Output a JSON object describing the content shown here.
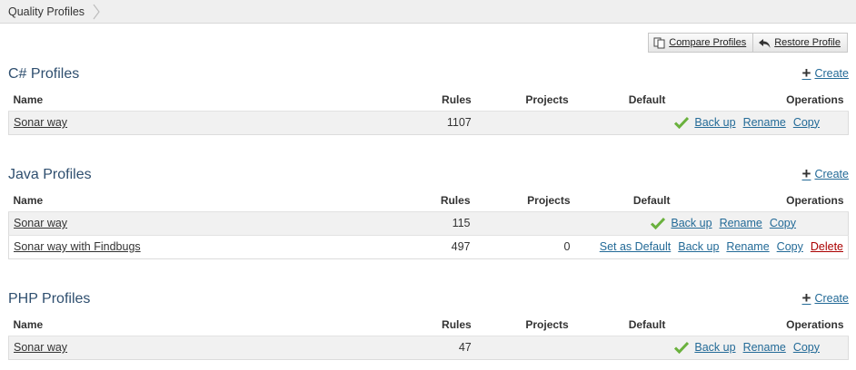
{
  "breadcrumb": {
    "label": "Quality Profiles"
  },
  "toolbar": {
    "compare_label": "Compare Profiles",
    "restore_label": "Restore Profile"
  },
  "columns": {
    "name": "Name",
    "rules": "Rules",
    "projects": "Projects",
    "default": "Default",
    "operations": "Operations"
  },
  "actions": {
    "create": "Create",
    "backup": "Back up",
    "rename": "Rename",
    "copy": "Copy",
    "delete": "Delete",
    "set_default": "Set as Default"
  },
  "sections": [
    {
      "title": "C# Profiles",
      "rows": [
        {
          "name": "Sonar way",
          "rules": "1107",
          "projects": "",
          "is_default": true
        }
      ]
    },
    {
      "title": "Java Profiles",
      "rows": [
        {
          "name": "Sonar way",
          "rules": "115",
          "projects": "",
          "is_default": true
        },
        {
          "name": "Sonar way with Findbugs",
          "rules": "497",
          "projects": "0",
          "is_default": false
        }
      ]
    },
    {
      "title": "PHP Profiles",
      "rows": [
        {
          "name": "Sonar way",
          "rules": "47",
          "projects": "",
          "is_default": true
        }
      ]
    }
  ],
  "colors": {
    "link": "#236a97",
    "title": "#2f4f6f",
    "check": "#6ab13d",
    "delete": "#aa0000"
  }
}
